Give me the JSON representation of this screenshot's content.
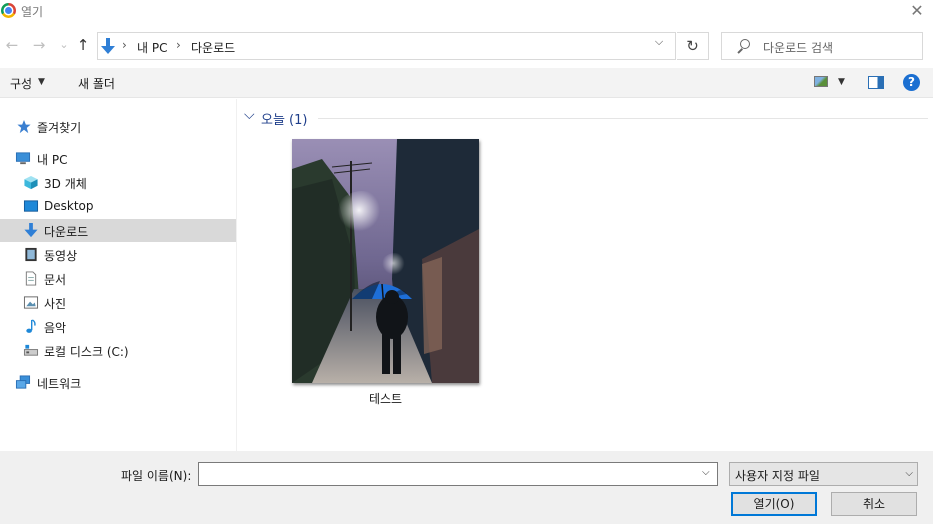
{
  "window": {
    "title": "열기"
  },
  "nav": {
    "back": "←",
    "forward": "→",
    "recent": "⌄",
    "up": "↑"
  },
  "address": {
    "crumbs": [
      "내 PC",
      "다운로드"
    ],
    "separator": "›",
    "dropdown": "⌵",
    "refresh": "↻"
  },
  "search": {
    "placeholder": "다운로드 검색"
  },
  "toolbar": {
    "organize": "구성",
    "organize_arrow": "▼",
    "new_folder": "새 폴더",
    "view_arrow": "▼",
    "help": "?"
  },
  "sidebar": {
    "items": [
      {
        "label": "즐겨찾기",
        "icon": "star-icon"
      },
      {
        "label": "내 PC",
        "icon": "pc-icon"
      },
      {
        "label": "3D 개체",
        "icon": "cube-icon"
      },
      {
        "label": "Desktop",
        "icon": "desktop-icon"
      },
      {
        "label": "다운로드",
        "icon": "download-icon",
        "selected": true
      },
      {
        "label": "동영상",
        "icon": "video-icon"
      },
      {
        "label": "문서",
        "icon": "document-icon"
      },
      {
        "label": "사진",
        "icon": "picture-icon"
      },
      {
        "label": "음악",
        "icon": "music-icon"
      },
      {
        "label": "로컬 디스크 (C:)",
        "icon": "drive-icon"
      },
      {
        "label": "네트워크",
        "icon": "network-icon"
      }
    ]
  },
  "content": {
    "group_label": "오늘 (1)",
    "group_chevron": "⌵",
    "files": [
      {
        "name": "테스트"
      }
    ]
  },
  "footer": {
    "filename_label": "파일 이름(N):",
    "filename_value": "",
    "filename_dropdown": "⌵",
    "filetype": "사용자 지정 파일",
    "filetype_dropdown": "⌵",
    "open_label": "열기(O)",
    "cancel_label": "취소"
  },
  "colors": {
    "accent": "#0078d7",
    "selected_bg": "#d9d9d9",
    "group_header": "#1e3e8a"
  }
}
